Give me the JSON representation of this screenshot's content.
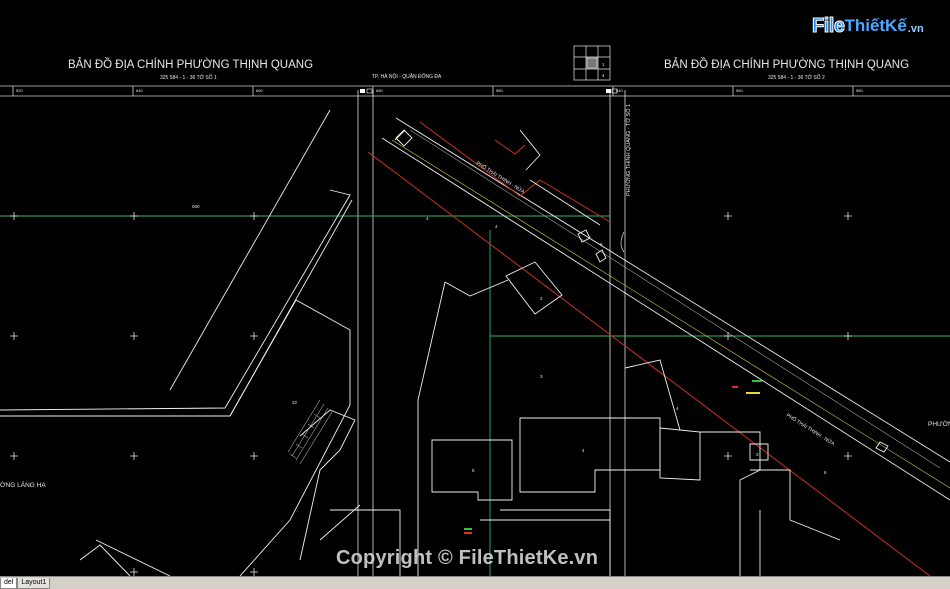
{
  "map": {
    "title_left": "BẢN ĐỒ ĐỊA CHÍNH PHƯỜNG THỊNH QUANG",
    "subtitle_left": "325 584 - 1 - 36 TỜ SỐ 1",
    "title_right": "BẢN ĐỒ ĐỊA CHÍNH PHƯỜNG THỊNH QUANG",
    "subtitle_right": "325 584 - 1 - 36 TỜ SỐ 2",
    "center_caption": "TP. HÀ NỘI - QUẬN ĐỐNG ĐA",
    "sheet_index": {
      "cell_top": "1",
      "cell_bottom": "4"
    },
    "ward_label_left": "ỜNG LÁNG HẠ",
    "ward_label_right": "PHƯỜN",
    "vertical_label": "PHƯỜNG THỊNH QUANG - TỜ SỐ 1",
    "street_label_1": "PHỐ THÁI THỊNH - NỬA",
    "street_label_2": "PHỐ THÁI THỊNH - NỬA",
    "parcel_labels": [
      "000",
      "4",
      "4",
      "2",
      "3",
      "4",
      "5",
      "22",
      "4",
      "3",
      "6",
      "8"
    ]
  },
  "tabs": {
    "model": "del",
    "layout1": "Layout1"
  },
  "watermark": {
    "logo_file": "File",
    "logo_rest": "ThiếtKế",
    "logo_vn": ".vn",
    "copyright": "Copyright © FileThietKe.vn"
  },
  "colors": {
    "background": "#000000",
    "lines": "#ffffff",
    "green_grid": "#2fb36a",
    "parcel_red": "#c8321e"
  }
}
